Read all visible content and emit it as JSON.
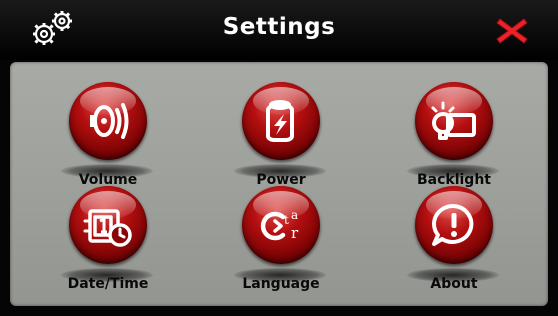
{
  "titlebar": {
    "title": "Settings",
    "app_icon": "gears-icon",
    "close_icon": "close-icon"
  },
  "colors": {
    "titlebar": "#000000",
    "panel": "#9ea09c",
    "orb": "#b40f10",
    "close": "#e8242a",
    "label": "#0a0a0a"
  },
  "tiles": [
    {
      "label": "Volume",
      "icon": "speaker-icon"
    },
    {
      "label": "Power",
      "icon": "battery-icon"
    },
    {
      "label": "Backlight",
      "icon": "backlight-icon"
    },
    {
      "label": "Date/Time",
      "icon": "calendar-clock-icon"
    },
    {
      "label": "Language",
      "icon": "language-icon"
    },
    {
      "label": "About",
      "icon": "about-icon"
    }
  ]
}
